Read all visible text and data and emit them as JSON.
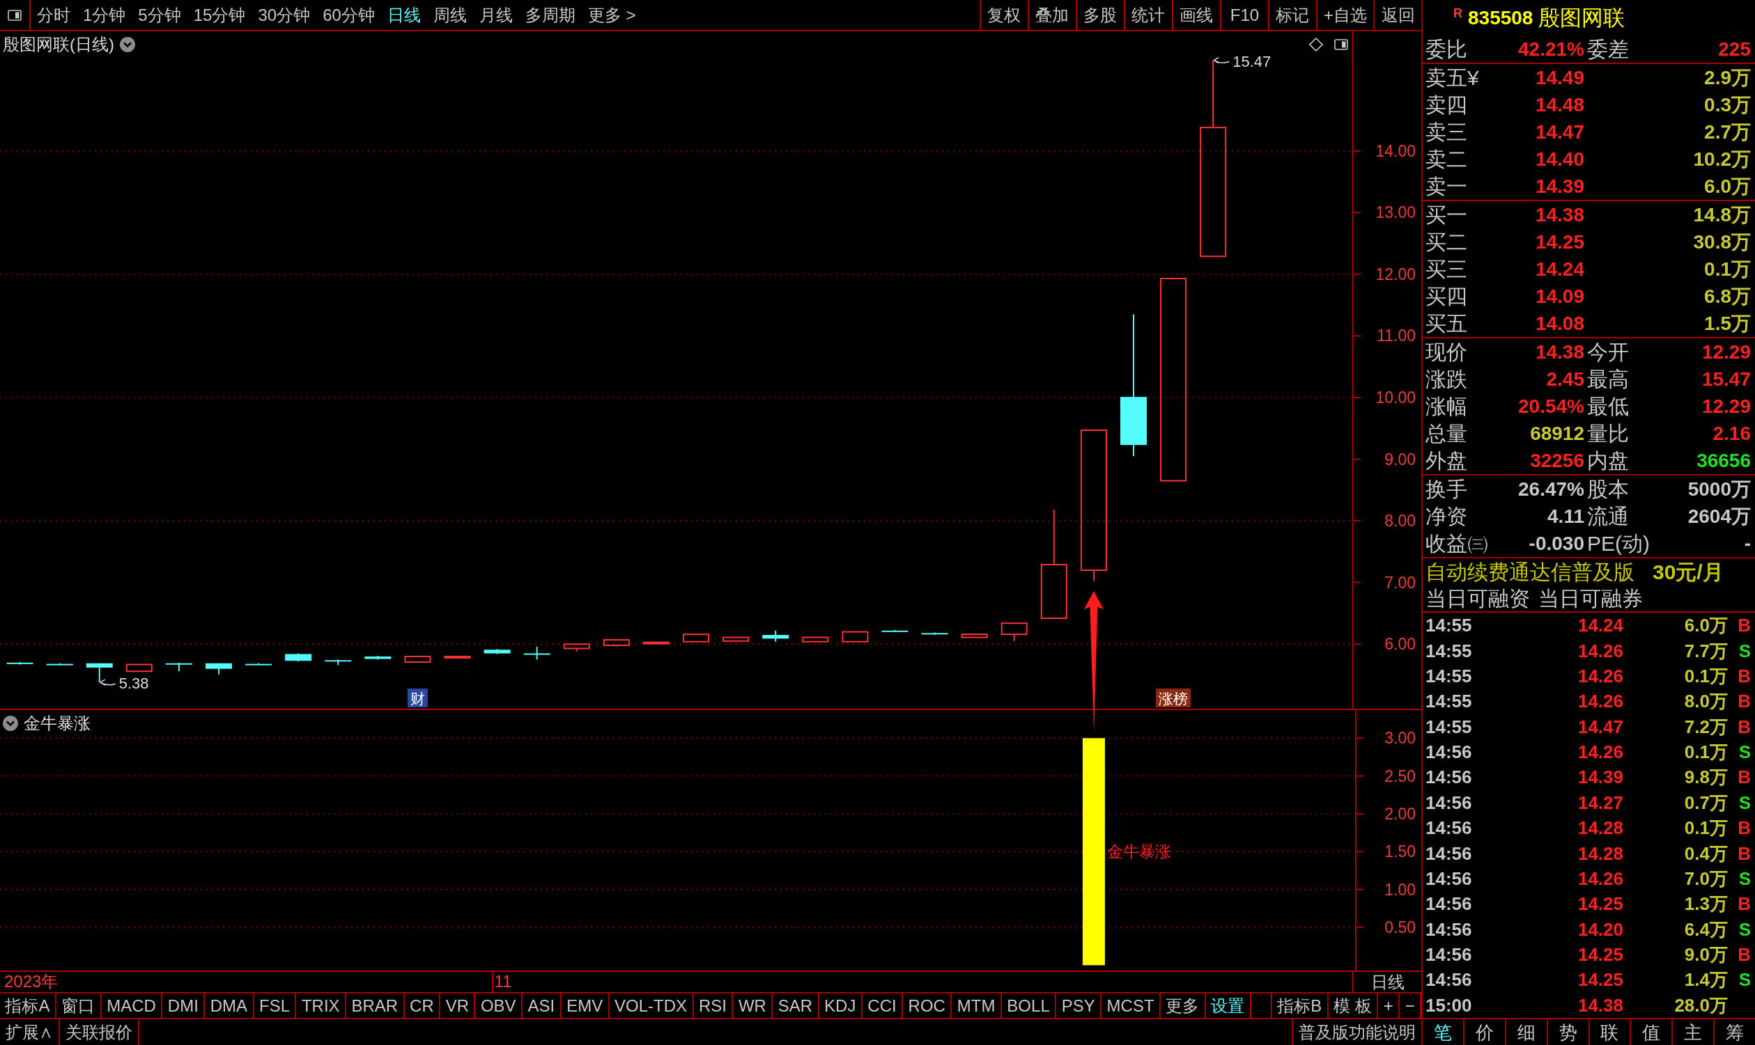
{
  "toolbar": {
    "periods": [
      {
        "label": "分时",
        "selected": false
      },
      {
        "label": "1分钟",
        "selected": false
      },
      {
        "label": "5分钟",
        "selected": false
      },
      {
        "label": "15分钟",
        "selected": false
      },
      {
        "label": "30分钟",
        "selected": false
      },
      {
        "label": "60分钟",
        "selected": false
      },
      {
        "label": "日线",
        "selected": true
      },
      {
        "label": "周线",
        "selected": false
      },
      {
        "label": "月线",
        "selected": false
      },
      {
        "label": "多周期",
        "selected": false
      },
      {
        "label": "更多 >",
        "selected": false
      }
    ],
    "actions": [
      "复权",
      "叠加",
      "多股",
      "统计",
      "画线",
      "F10",
      "标记",
      "+自选",
      "返回"
    ]
  },
  "main_chart": {
    "title": "殷图网联(日线)",
    "axis_labels": [
      "14.00",
      "13.00",
      "12.00",
      "11.00",
      "10.00",
      "9.00",
      "8.00",
      "7.00",
      "6.00"
    ],
    "high_label": "15.47",
    "low_label": "5.38",
    "markers": [
      {
        "text": "财",
        "color": "#2848a0"
      },
      {
        "text": "涨榜",
        "color": "#8a2a12"
      }
    ]
  },
  "indicator_chart": {
    "chart_data": {
      "type": "bar",
      "title": "金牛暴涨",
      "categories": [
        null,
        null,
        null,
        null,
        null,
        null,
        null,
        null,
        null,
        null,
        null,
        null,
        null,
        null,
        null,
        null,
        null,
        null,
        null,
        null,
        null,
        null,
        null,
        null,
        null,
        null,
        null,
        null,
        null,
        null,
        null,
        null,
        null,
        null
      ],
      "series": [
        {
          "color": "#ffff00",
          "values": [
            0,
            0,
            0,
            0,
            0,
            0,
            0,
            0,
            0,
            0,
            0,
            0,
            0,
            0,
            0,
            0,
            0,
            0,
            0,
            0,
            0,
            0,
            0,
            0,
            0,
            0,
            0,
            3,
            0,
            0,
            0,
            null,
            null,
            null
          ]
        }
      ],
      "ylim": [
        -0.07,
        3.37
      ],
      "yticks": [
        {
          "value": 3,
          "label": "3.00"
        },
        {
          "value": 2.5,
          "label": "2.50"
        },
        {
          "value": 2,
          "label": "2.00"
        },
        {
          "value": 1.5,
          "label": "1.50"
        },
        {
          "value": 1,
          "label": "1.00"
        },
        {
          "value": 0.5,
          "label": "0.50"
        }
      ],
      "grid": true,
      "annotations": [
        {
          "text": "金牛暴涨"
        }
      ]
    }
  },
  "date_axis": {
    "labels": [
      "2023年",
      "11"
    ],
    "period_label": "日线"
  },
  "indicator_bar": {
    "left": [
      {
        "label": "指标A",
        "highlighted": false
      },
      {
        "label": "窗口",
        "highlighted": false
      },
      {
        "label": "MACD",
        "highlighted": false
      },
      {
        "label": "DMI",
        "highlighted": false
      },
      {
        "label": "DMA",
        "highlighted": false
      },
      {
        "label": "FSL",
        "highlighted": false
      },
      {
        "label": "TRIX",
        "highlighted": false
      },
      {
        "label": "BRAR",
        "highlighted": false
      },
      {
        "label": "CR",
        "highlighted": false
      },
      {
        "label": "VR",
        "highlighted": false
      },
      {
        "label": "OBV",
        "highlighted": false
      },
      {
        "label": "ASI",
        "highlighted": false
      },
      {
        "label": "EMV",
        "highlighted": false
      },
      {
        "label": "VOL-TDX",
        "highlighted": false
      },
      {
        "label": "RSI",
        "highlighted": false
      },
      {
        "label": "WR",
        "highlighted": false
      },
      {
        "label": "SAR",
        "highlighted": false
      },
      {
        "label": "KDJ",
        "highlighted": false
      },
      {
        "label": "CCI",
        "highlighted": false
      },
      {
        "label": "ROC",
        "highlighted": false
      },
      {
        "label": "MTM",
        "highlighted": false
      },
      {
        "label": "BOLL",
        "highlighted": false
      },
      {
        "label": "PSY",
        "highlighted": false
      },
      {
        "label": "MCST",
        "highlighted": false
      },
      {
        "label": "更多",
        "highlighted": false
      },
      {
        "label": "设置",
        "highlighted": true
      }
    ],
    "right": [
      {
        "label": "指标B",
        "highlighted": false
      },
      {
        "label": "模 板",
        "highlighted": false
      },
      {
        "label": "+",
        "highlighted": false
      },
      {
        "label": "−",
        "highlighted": false
      }
    ]
  },
  "status_bar": {
    "left": [
      "扩展∧",
      "关联报价"
    ],
    "right": "普及版功能说明"
  },
  "quote": {
    "flag": "R",
    "code": "835508",
    "name": "殷图网联",
    "summary": [
      {
        "label": "委比",
        "value": "42.21%",
        "color": "#ff2020"
      },
      {
        "label": "委差",
        "value": "225",
        "color": "#ff2020"
      }
    ],
    "asks": [
      {
        "label": "卖五¥",
        "price": "14.49",
        "volume": "2.9万"
      },
      {
        "label": "卖四",
        "price": "14.48",
        "volume": "0.3万"
      },
      {
        "label": "卖三",
        "price": "14.47",
        "volume": "2.7万"
      },
      {
        "label": "卖二",
        "price": "14.40",
        "volume": "10.2万"
      },
      {
        "label": "卖一",
        "price": "14.39",
        "volume": "6.0万"
      }
    ],
    "bids": [
      {
        "label": "买一",
        "price": "14.38",
        "volume": "14.8万"
      },
      {
        "label": "买二",
        "price": "14.25",
        "volume": "30.8万"
      },
      {
        "label": "买三",
        "price": "14.24",
        "volume": "0.1万"
      },
      {
        "label": "买四",
        "price": "14.09",
        "volume": "6.8万"
      },
      {
        "label": "买五",
        "price": "14.08",
        "volume": "1.5万"
      }
    ],
    "stats": [
      [
        {
          "label": "现价",
          "value": "14.38",
          "color": "#ff2020"
        },
        {
          "label": "今开",
          "value": "12.29",
          "color": "#ff2020"
        }
      ],
      [
        {
          "label": "涨跌",
          "value": "2.45",
          "color": "#ff2020"
        },
        {
          "label": "最高",
          "value": "15.47",
          "color": "#ff2020"
        }
      ],
      [
        {
          "label": "涨幅",
          "value": "20.54%",
          "color": "#ff2020"
        },
        {
          "label": "最低",
          "value": "12.29",
          "color": "#ff2020"
        }
      ],
      [
        {
          "label": "总量",
          "value": "68912",
          "color": "#c8c832"
        },
        {
          "label": "量比",
          "value": "2.16",
          "color": "#ff2020"
        }
      ],
      [
        {
          "label": "外盘",
          "value": "32256",
          "color": "#ff2020"
        },
        {
          "label": "内盘",
          "value": "36656",
          "color": "#20e020"
        }
      ]
    ],
    "fundamentals": [
      [
        {
          "label": "换手",
          "value": "26.47%"
        },
        {
          "label": "股本",
          "value": "5000万"
        }
      ],
      [
        {
          "label": "净资",
          "value": "4.11"
        },
        {
          "label": "流通",
          "value": "2604万"
        }
      ],
      [
        {
          "label": "收益㈢",
          "value": "-0.030"
        },
        {
          "label": "PE(动)",
          "value": "-"
        }
      ]
    ],
    "promo": {
      "text": "自动续费通达信普及版",
      "price": "30元/月"
    },
    "margin": [
      "当日可融资",
      "当日可融券"
    ],
    "trades": [
      {
        "time": "14:55",
        "price": "14.24",
        "volume": "6.0万",
        "side": "B",
        "kind": "buy"
      },
      {
        "time": "14:55",
        "price": "14.26",
        "volume": "7.7万",
        "side": "S",
        "kind": "sell"
      },
      {
        "time": "14:55",
        "price": "14.26",
        "volume": "0.1万",
        "side": "B",
        "kind": "buy"
      },
      {
        "time": "14:55",
        "price": "14.26",
        "volume": "8.0万",
        "side": "B",
        "kind": "buy"
      },
      {
        "time": "14:55",
        "price": "14.47",
        "volume": "7.2万",
        "side": "B",
        "kind": "buy"
      },
      {
        "time": "14:56",
        "price": "14.26",
        "volume": "0.1万",
        "side": "S",
        "kind": "sell"
      },
      {
        "time": "14:56",
        "price": "14.39",
        "volume": "9.8万",
        "side": "B",
        "kind": "buy"
      },
      {
        "time": "14:56",
        "price": "14.27",
        "volume": "0.7万",
        "side": "S",
        "kind": "sell"
      },
      {
        "time": "14:56",
        "price": "14.28",
        "volume": "0.1万",
        "side": "B",
        "kind": "buy"
      },
      {
        "time": "14:56",
        "price": "14.28",
        "volume": "0.4万",
        "side": "B",
        "kind": "buy"
      },
      {
        "time": "14:56",
        "price": "14.26",
        "volume": "7.0万",
        "side": "S",
        "kind": "sell"
      },
      {
        "time": "14:56",
        "price": "14.25",
        "volume": "1.3万",
        "side": "B",
        "kind": "buy"
      },
      {
        "time": "14:56",
        "price": "14.20",
        "volume": "6.4万",
        "side": "S",
        "kind": "sell"
      },
      {
        "time": "14:56",
        "price": "14.25",
        "volume": "9.0万",
        "side": "B",
        "kind": "buy"
      },
      {
        "time": "14:56",
        "price": "14.25",
        "volume": "1.4万",
        "side": "S",
        "kind": "sell"
      },
      {
        "time": "15:00",
        "price": "14.38",
        "volume": "28.0万"
      }
    ],
    "tabs": [
      {
        "label": "笔",
        "selected": true
      },
      {
        "label": "价",
        "selected": false
      },
      {
        "label": "细",
        "selected": false
      },
      {
        "label": "势",
        "selected": false
      },
      {
        "label": "联",
        "selected": false
      },
      {
        "label": "值",
        "selected": false
      },
      {
        "label": "主",
        "selected": false
      },
      {
        "label": "筹",
        "selected": false
      }
    ]
  }
}
